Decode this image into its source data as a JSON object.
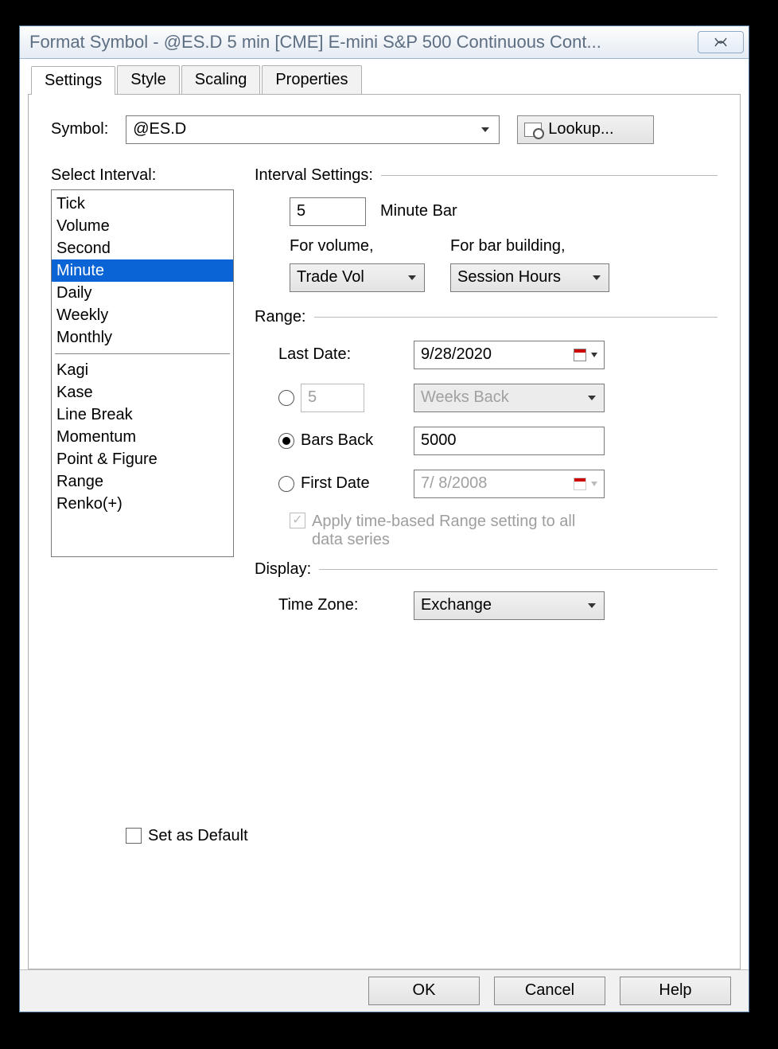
{
  "window": {
    "title": "Format Symbol - @ES.D 5 min [CME] E-mini S&P 500 Continuous Cont..."
  },
  "tabs": {
    "items": [
      "Settings",
      "Style",
      "Scaling",
      "Properties"
    ],
    "active": "Settings"
  },
  "symbol": {
    "label": "Symbol:",
    "value": "@ES.D",
    "lookup_label": "Lookup..."
  },
  "intervalPanel": {
    "header": "Select Interval:",
    "items_a": [
      "Tick",
      "Volume",
      "Second",
      "Minute",
      "Daily",
      "Weekly",
      "Monthly"
    ],
    "items_b": [
      "Kagi",
      "Kase",
      "Line Break",
      "Momentum",
      "Point & Figure",
      "Range",
      "Renko(+)"
    ],
    "selected": "Minute"
  },
  "intervalSettings": {
    "header": "Interval Settings:",
    "bar_value": "5",
    "bar_suffix": "Minute Bar",
    "for_volume_label": "For volume,",
    "for_bar_label": "For bar building,",
    "volume_dd": "Trade Vol",
    "bar_build_dd": "Session Hours"
  },
  "range": {
    "header": "Range:",
    "last_date_label": "Last Date:",
    "last_date_value": "9/28/2020",
    "weeks_back_value": "5",
    "weeks_back_label": "Weeks Back",
    "bars_back_label": "Bars Back",
    "bars_back_value": "5000",
    "first_date_label": "First Date",
    "first_date_value": "7/ 8/2008",
    "apply_label": "Apply time-based Range setting to all data series",
    "selected": "bars"
  },
  "display": {
    "header": "Display:",
    "tz_label": "Time Zone:",
    "tz_value": "Exchange"
  },
  "set_default_label": "Set as Default",
  "footer": {
    "ok": "OK",
    "cancel": "Cancel",
    "help": "Help"
  }
}
